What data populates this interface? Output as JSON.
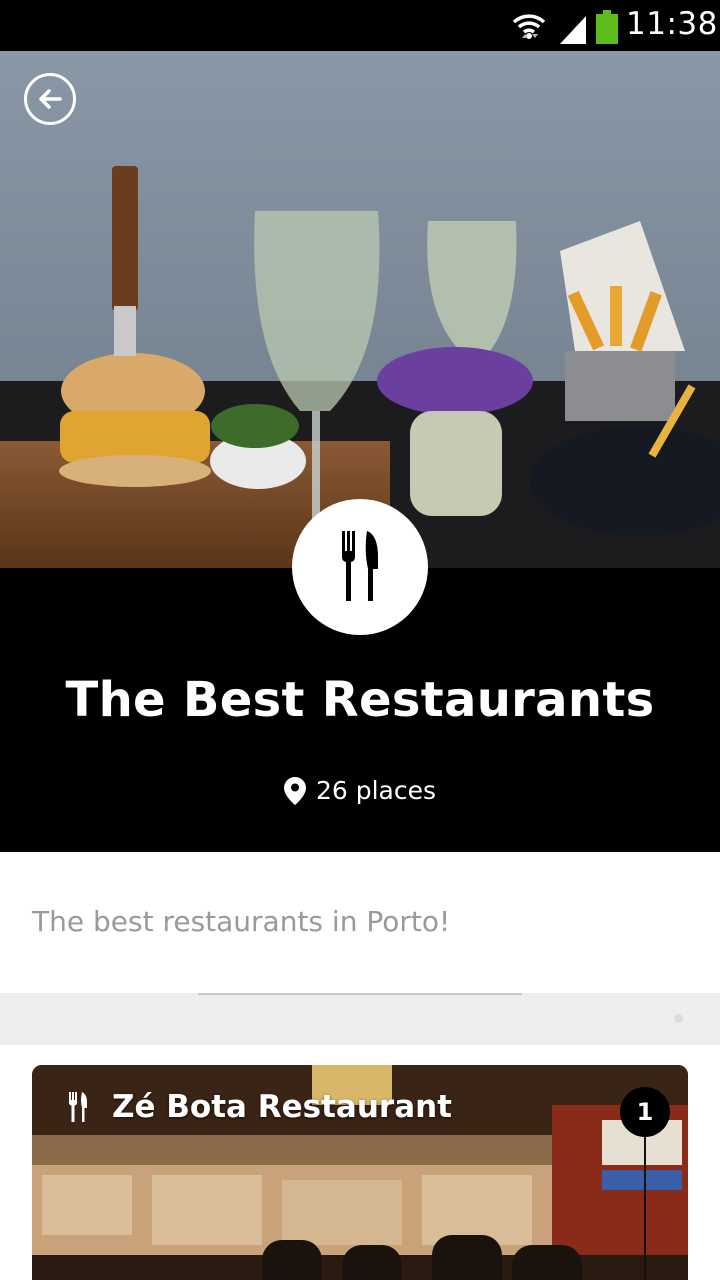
{
  "status_bar": {
    "time": "11:38",
    "icons": [
      "wifi-icon",
      "signal-icon",
      "battery-icon"
    ]
  },
  "header": {
    "back_icon": "back-arrow-icon",
    "category_icon": "cutlery-icon",
    "title": "The Best Restaurants",
    "places_icon": "location-pin-icon",
    "places_count": "26 places"
  },
  "description": "The best restaurants in Porto!",
  "places": [
    {
      "icon": "cutlery-icon",
      "name": "Zé Bota Restaurant",
      "number": "1"
    }
  ],
  "colors": {
    "header_bg": "#000000",
    "description_text": "#9a9a9a",
    "divider_bg": "#eeeeee"
  }
}
